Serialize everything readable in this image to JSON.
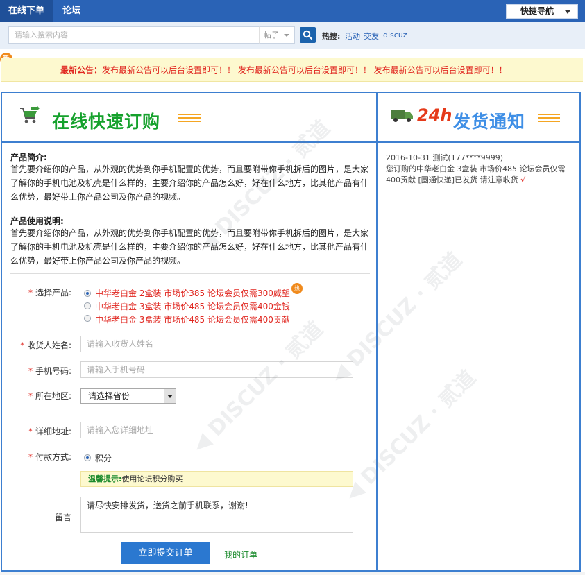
{
  "topnav": {
    "tabs": [
      {
        "label": "在线下单",
        "active": true
      },
      {
        "label": "论坛",
        "active": false
      }
    ],
    "quick_nav": "快捷导航"
  },
  "search": {
    "placeholder": "请输入搜索内容",
    "type": "帖子",
    "hot_label": "热搜:",
    "hot_links": [
      "活动",
      "交友",
      "discuz"
    ]
  },
  "announcement": {
    "badge": "新",
    "label": "最新公告：",
    "text": "发布最新公告可以后台设置即可！！ 发布最新公告可以后台设置即可！！ 发布最新公告可以后台设置即可！！"
  },
  "order_panel": {
    "title": "在线快速订购",
    "intro_title": "产品简介:",
    "intro_body": "首先要介绍你的产品，从外观的优势到你手机配置的优势，而且要附带你手机拆后的图片，是大家了解你的手机电池及机壳是什么样的，主要介绍你的产品怎么好，好在什么地方，比其他产品有什么优势，最好带上你产品公司及你产品的视频。",
    "usage_title": "产品使用说明:",
    "usage_body": "首先要介绍你的产品，从外观的优势到你手机配置的优势，而且要附带你手机拆后的图片，是大家了解你的手机电池及机壳是什么样的，主要介绍你的产品怎么好，好在什么地方，比其他产品有什么优势，最好带上你产品公司及你产品的视频。"
  },
  "form": {
    "product_label": "选择产品:",
    "products": [
      {
        "label": "中华老白金 2盒装 市场价385 论坛会员仅需300威望",
        "selected": true,
        "hot": "热"
      },
      {
        "label": "中华老白金 3盒装 市场价485 论坛会员仅需400金钱",
        "selected": false
      },
      {
        "label": "中华老白金 3盒装 市场价485 论坛会员仅需400贡献",
        "selected": false
      }
    ],
    "name_label": "收货人姓名:",
    "name_placeholder": "请输入收货人姓名",
    "phone_label": "手机号码:",
    "phone_placeholder": "请输入手机号码",
    "region_label": "所在地区:",
    "region_value": "请选择省份",
    "address_label": "详细地址:",
    "address_placeholder": "请输入您详细地址",
    "pay_label": "付款方式:",
    "pay_option": "积分",
    "tip_label": "温馨提示:",
    "tip_text": "使用论坛积分购买",
    "message_label": "留言",
    "message_value": "请尽快安排发货，送货之前手机联系，谢谢!",
    "submit_label": "立即提交订单",
    "my_orders_label": "我的订单"
  },
  "shipping_panel": {
    "badge": "24h",
    "title": "发货通知",
    "notices": [
      {
        "line1": "2016-10-31 测试(177****9999)",
        "line2": "您订购的中华老白金 3盒装 市场价485 论坛会员仅需400贡献 [圆通快递]已发货 请注意收货",
        "check": "√"
      }
    ]
  },
  "colors": {
    "nav_blue": "#2a63b6",
    "frame_blue": "#3d7fd0",
    "accent_red": "#e0261f",
    "green": "#15a12c",
    "notice_bg": "#fdf9cf"
  }
}
